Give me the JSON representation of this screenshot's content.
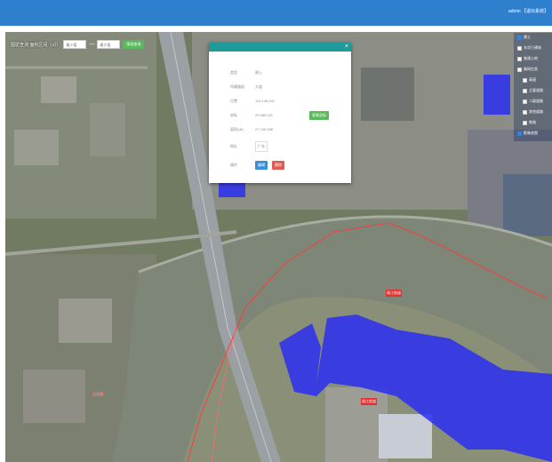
{
  "header": {
    "user_text": "admin 【退出系统】"
  },
  "toolbar": {
    "label": "图斑查询 面积区间（㎡）",
    "min_placeholder": "最小值",
    "max_placeholder": "最大值",
    "separator": "—",
    "query_button": "图斑查询"
  },
  "popup": {
    "close": "×",
    "rows": [
      {
        "label": "类型",
        "value": "建土"
      },
      {
        "label": "所属路段",
        "value": "大道"
      },
      {
        "label": "位置",
        "value": "113.146 091"
      },
      {
        "label": "坐标",
        "value": "23.085 021"
      },
      {
        "label": "面积(㎡)",
        "value": "27.745 998"
      },
      {
        "label": "地址",
        "value": "广东"
      }
    ],
    "copy_button": "复制坐标",
    "op_label": "操作",
    "edit_button": "编辑",
    "delete_button": "删除"
  },
  "layers": {
    "items": [
      {
        "label": "建土",
        "checked": true
      },
      {
        "label": "东华已建筑",
        "checked": false
      },
      {
        "label": "普通土地",
        "checked": false
      },
      {
        "label": "路网信息",
        "checked": false
      },
      {
        "label": "高速",
        "checked": false
      },
      {
        "label": "主要道路",
        "checked": false
      },
      {
        "label": "二级道路",
        "checked": false
      },
      {
        "label": "其他道路",
        "checked": false
      },
      {
        "label": "铁路",
        "checked": false
      },
      {
        "label": "影像底图",
        "checked": true
      }
    ]
  },
  "map_labels": {
    "river_label_1": "珠江航道",
    "river_label_2": "珠江航道",
    "place_label": "大石镇"
  },
  "colors": {
    "header": "#2f7fcf",
    "polygon": "#2a2ef0",
    "popup_header": "#1e9a9a",
    "boundary": "#ff3b3b"
  }
}
